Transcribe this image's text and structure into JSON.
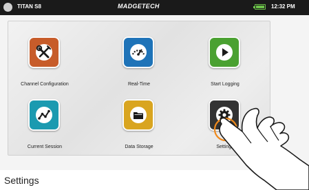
{
  "status_bar": {
    "device_name": "TITAN S8",
    "brand": "MADGETECH",
    "time": "12:32 PM",
    "battery_icon": "battery-full-icon"
  },
  "menu": {
    "tiles": [
      {
        "label": "Channel Configuration",
        "icon": "wrench-screwdriver-icon",
        "color": "#c75c2a"
      },
      {
        "label": "Real-Time",
        "icon": "gauge-icon",
        "color": "#1e73b8"
      },
      {
        "label": "Start Logging",
        "icon": "play-icon",
        "color": "#4aa131"
      },
      {
        "label": "Current Session",
        "icon": "line-graph-icon",
        "color": "#1b9ab0"
      },
      {
        "label": "Data Storage",
        "icon": "folder-icon",
        "color": "#d9a520"
      },
      {
        "label": "Settings",
        "icon": "gear-icon",
        "color": "#333333"
      }
    ]
  },
  "highlight_color": "#f08a1c",
  "caption": "Settings"
}
